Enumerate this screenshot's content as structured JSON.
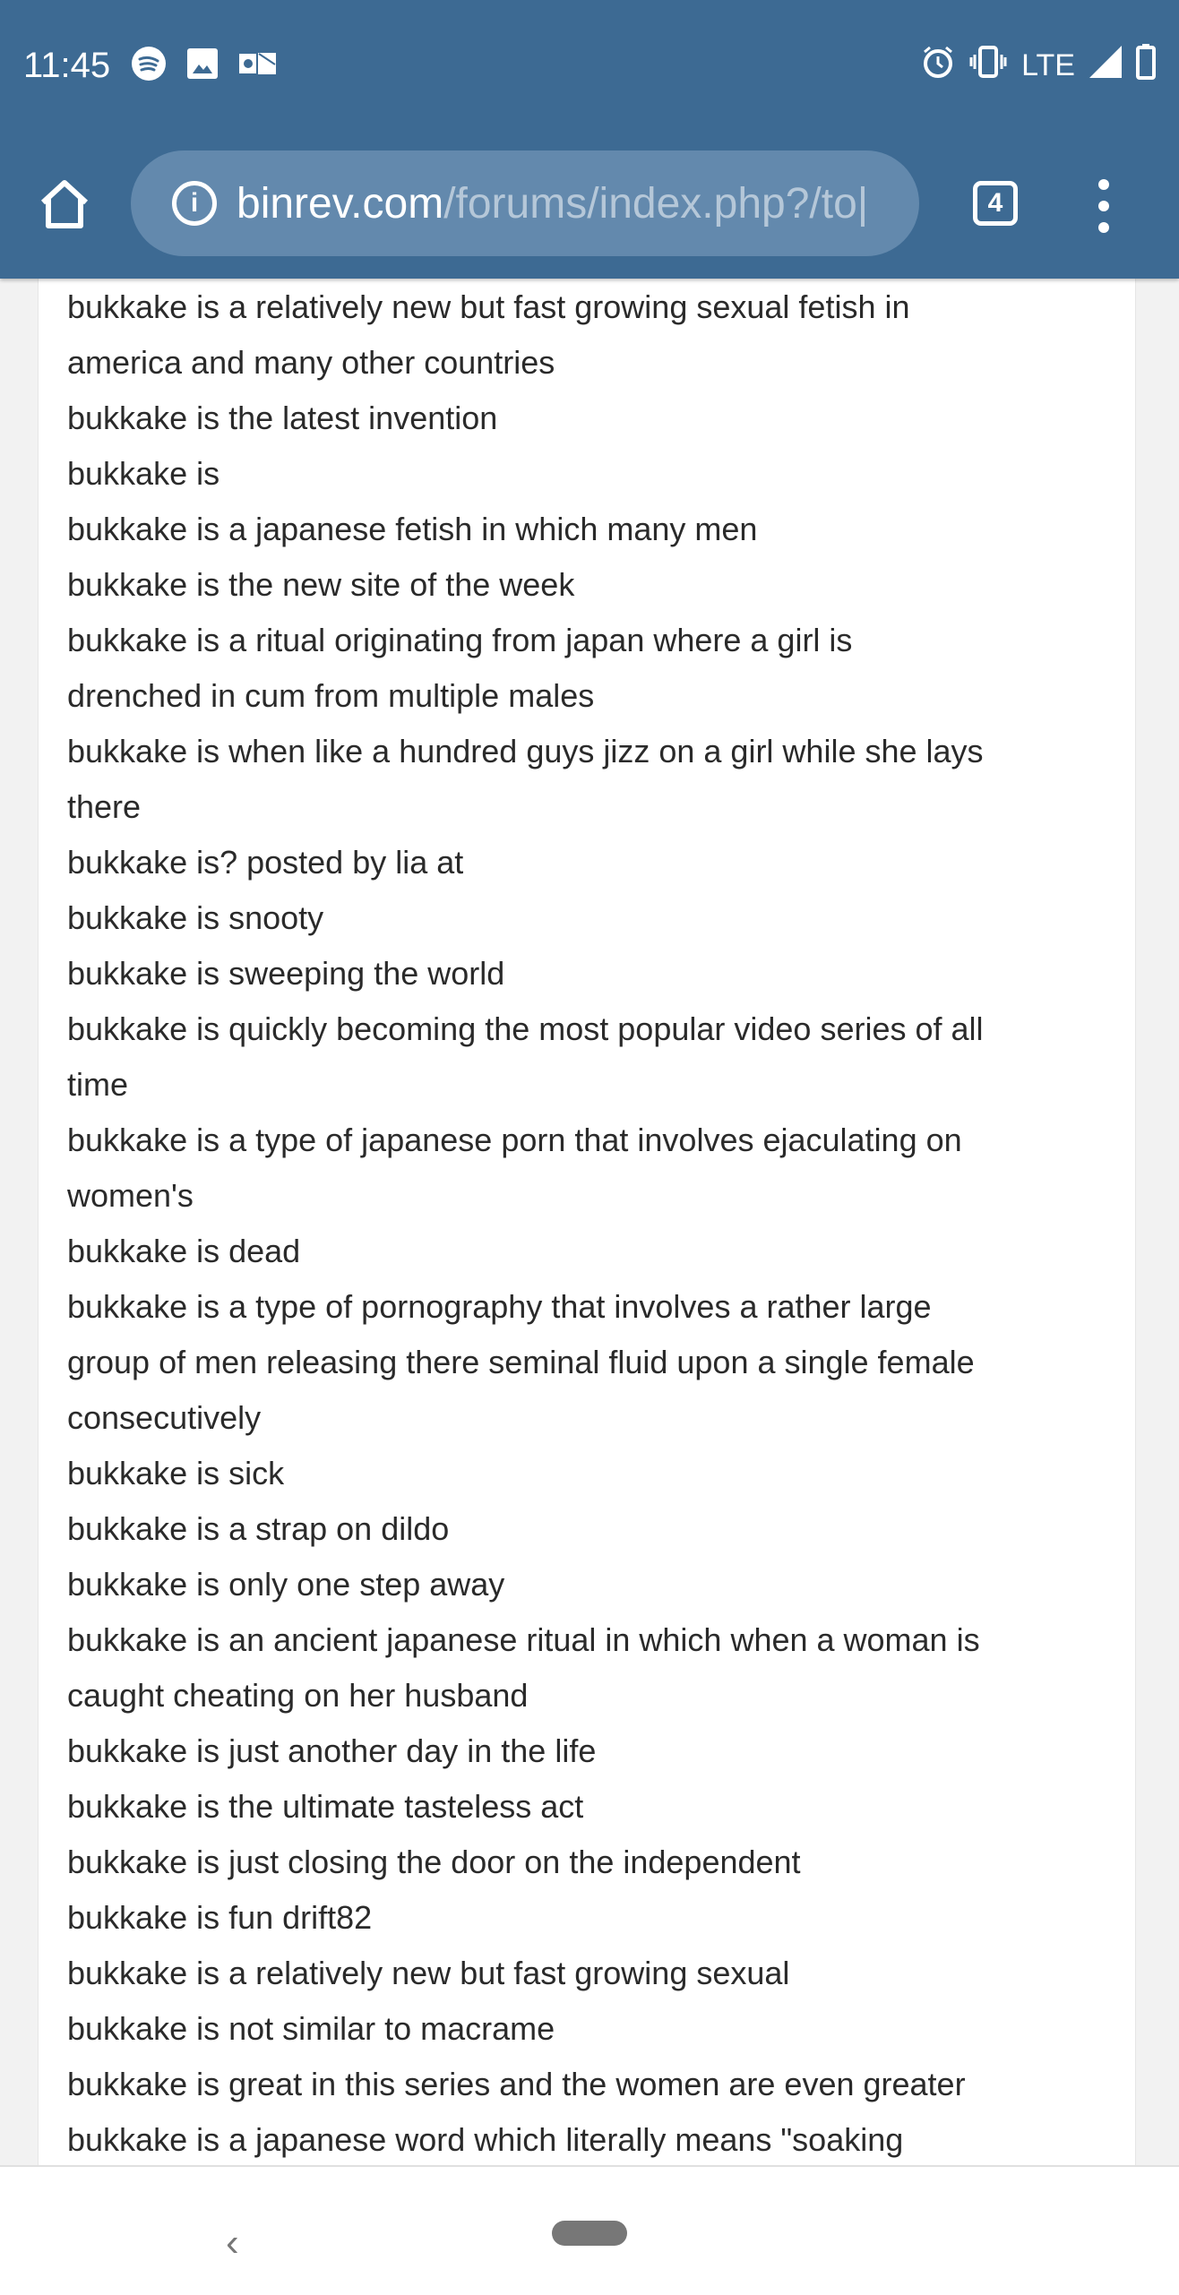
{
  "status_bar": {
    "time": "11:45",
    "network": "LTE",
    "left_icons": [
      "spotify-icon",
      "image-icon",
      "outlook-icon"
    ],
    "right_icons": [
      "alarm-icon",
      "vibrate-icon",
      "signal-icon",
      "battery-icon"
    ]
  },
  "browser": {
    "url_domain": "binrev.com",
    "url_path": "/forums/index.php?/to|",
    "tab_count": "4",
    "toolbar_color": "#3d6a93"
  },
  "items": [
    {
      "lines": [
        "bukkake is a relatively new but fast growing sexual fetish in",
        "america and many other countries"
      ]
    },
    {
      "lines": [
        "bukkake is the latest invention"
      ]
    },
    {
      "lines": [
        "bukkake is"
      ]
    },
    {
      "lines": [
        "bukkake is a japanese fetish in which many men"
      ]
    },
    {
      "lines": [
        "bukkake is the new site of the week"
      ]
    },
    {
      "lines": [
        "bukkake is a ritual originating from japan where a girl is",
        "drenched in cum from multiple males"
      ]
    },
    {
      "lines": [
        "bukkake is when like a hundred guys jizz on a girl while she lays",
        "there"
      ]
    },
    {
      "lines": [
        "bukkake is? posted by lia at"
      ]
    },
    {
      "lines": [
        "bukkake is snooty"
      ]
    },
    {
      "lines": [
        "bukkake is sweeping the world"
      ]
    },
    {
      "lines": [
        "bukkake is quickly becoming the most popular video series of all",
        "time"
      ]
    },
    {
      "lines": [
        "bukkake is a type of japanese porn that involves ejaculating on",
        "women's"
      ]
    },
    {
      "lines": [
        "bukkake is dead"
      ]
    },
    {
      "lines": [
        "bukkake is a type of pornography that involves a rather large",
        "group of men releasing there seminal fluid upon a single female",
        "consecutively"
      ]
    },
    {
      "lines": [
        "bukkake is sick"
      ]
    },
    {
      "lines": [
        "bukkake is a strap on dildo"
      ]
    },
    {
      "lines": [
        "bukkake is only one step away"
      ]
    },
    {
      "lines": [
        "bukkake is an ancient japanese ritual in which when a woman is",
        "caught cheating on her husband"
      ]
    },
    {
      "lines": [
        "bukkake is just another day in the life"
      ]
    },
    {
      "lines": [
        "bukkake is the ultimate tasteless act"
      ]
    },
    {
      "lines": [
        "bukkake is just closing the door on the independent"
      ]
    },
    {
      "lines": [
        "bukkake is fun drift82"
      ]
    },
    {
      "lines": [
        "bukkake is a relatively new but fast growing sexual"
      ]
    },
    {
      "lines": [
        "bukkake is not similar to macrame"
      ]
    },
    {
      "lines": [
        "bukkake is great in this series and the women are even greater"
      ]
    },
    {
      "lines": [
        "bukkake is a japanese word which literally means \"soaking"
      ]
    }
  ]
}
